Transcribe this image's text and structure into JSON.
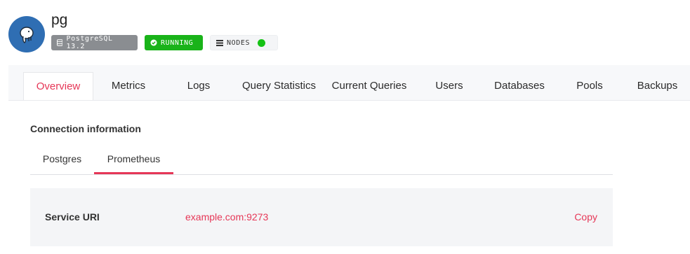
{
  "service": {
    "name": "pg",
    "logo_icon": "elephant-icon",
    "badges": {
      "version": "PostgreSQL 13.2",
      "status": "RUNNING",
      "nodes": "NODES"
    }
  },
  "tabs": [
    {
      "label": "Overview",
      "active": true
    },
    {
      "label": "Metrics"
    },
    {
      "label": "Logs"
    },
    {
      "label": "Query Statistics"
    },
    {
      "label": "Current Queries"
    },
    {
      "label": "Users"
    },
    {
      "label": "Databases"
    },
    {
      "label": "Pools"
    },
    {
      "label": "Backups"
    }
  ],
  "connection": {
    "title": "Connection information",
    "subtabs": [
      {
        "label": "Postgres"
      },
      {
        "label": "Prometheus",
        "active": true
      }
    ],
    "row": {
      "label": "Service URI",
      "value": "example.com:9273",
      "action": "Copy"
    }
  },
  "colors": {
    "accent": "#e63757",
    "running": "#19b319",
    "node_ok": "#15c215",
    "logo_bg": "#2f6eb3"
  }
}
